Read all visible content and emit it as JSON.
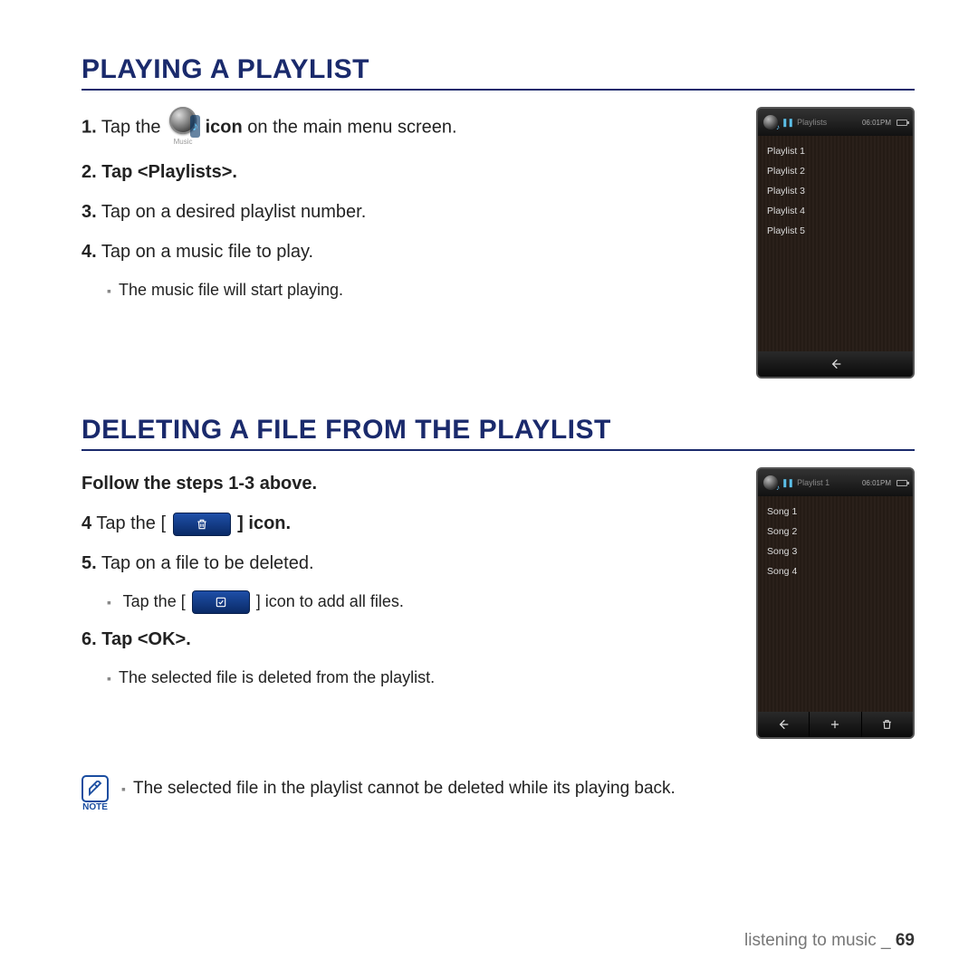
{
  "section1": {
    "title": "PLAYING A PLAYLIST",
    "step1_a": "1.",
    "step1_b": " Tap the ",
    "step1_c": " icon",
    "step1_d": " on the main menu screen.",
    "music_label": "Music",
    "step2_a": "2.",
    "step2_b": " Tap <Playlists>.",
    "step3_a": "3.",
    "step3_b": " Tap on a desired playlist number.",
    "step4_a": "4.",
    "step4_b": " Tap on a music file to play.",
    "sub1": "The music file will start playing."
  },
  "device1": {
    "crumb": "Playlists",
    "time": "06:01PM",
    "items": [
      "Playlist 1",
      "Playlist 2",
      "Playlist 3",
      "Playlist 4",
      "Playlist 5"
    ]
  },
  "section2": {
    "title": "DELETING A FILE FROM THE PLAYLIST",
    "intro": "Follow the steps 1-3 above.",
    "step4_a": "4",
    "step4_b": " Tap the [ ",
    "step4_c": " ] icon.",
    "step5_a": "5.",
    "step5_b": " Tap on a file to be deleted.",
    "sub5_a": "Tap the [ ",
    "sub5_b": " ] icon to add all files.",
    "step6_a": "6.",
    "step6_b": " Tap <OK>.",
    "sub6": "The selected file is deleted from the playlist."
  },
  "device2": {
    "crumb": "Playlist 1",
    "time": "06:01PM",
    "items": [
      "Song 1",
      "Song 2",
      "Song 3",
      "Song 4"
    ]
  },
  "note": {
    "label": "NOTE",
    "text": "The selected file in the playlist cannot be deleted while its playing back."
  },
  "footer": {
    "section": "listening to music _ ",
    "page": "69"
  }
}
